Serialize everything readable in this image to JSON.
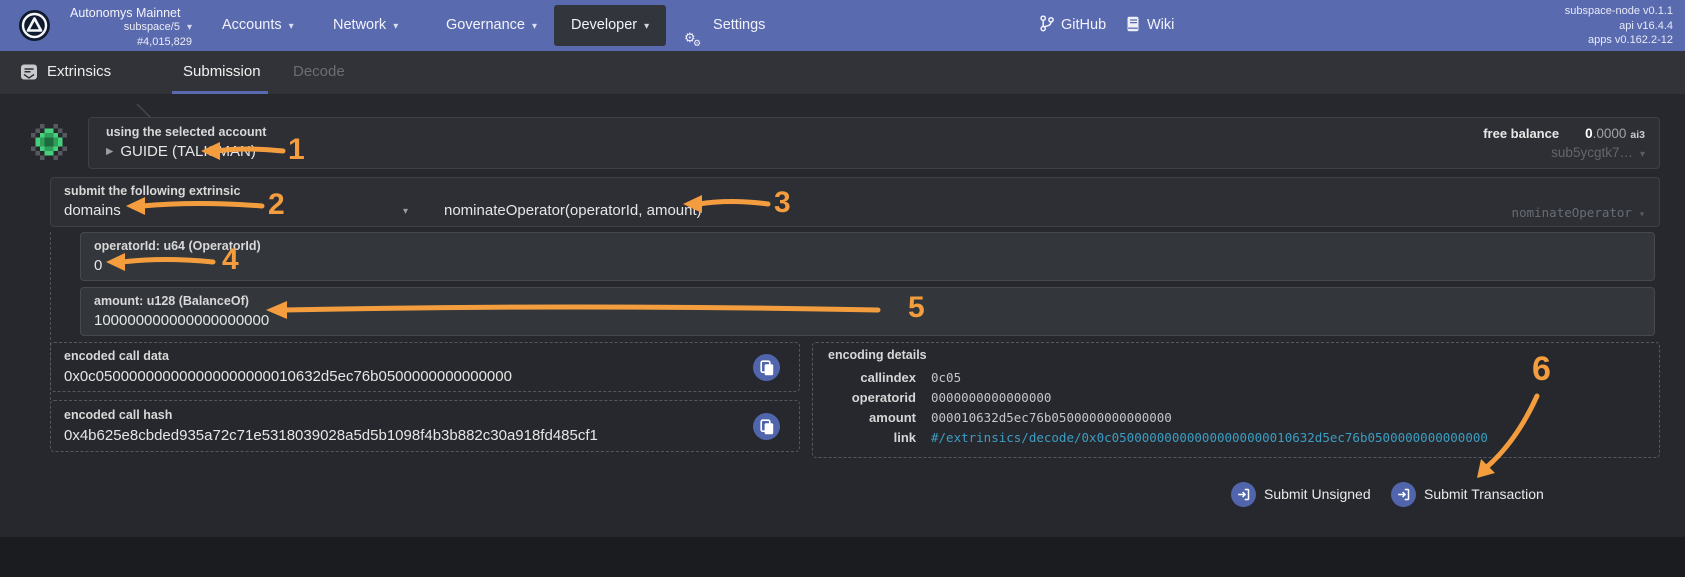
{
  "colors": {
    "nav_blue": "#5a6aae",
    "accent_orange": "#f39d3f",
    "link_blue": "#3d9dc2",
    "button_blue": "#5165ad"
  },
  "nav": {
    "brand": {
      "name": "Autonomys Mainnet",
      "runtime": "subspace/5",
      "block": "#4,015,829"
    },
    "menu": [
      {
        "label": "Accounts"
      },
      {
        "label": "Network"
      },
      {
        "label": "Governance"
      },
      {
        "label": "Developer"
      },
      {
        "label": "Settings"
      }
    ],
    "links": {
      "github": "GitHub",
      "wiki": "Wiki"
    },
    "versions": {
      "node": "subspace-node v0.1.1",
      "api": "api v16.4.4",
      "apps": "apps v0.162.2-12"
    }
  },
  "tabs": {
    "app": "Extrinsics",
    "items": [
      {
        "label": "Submission"
      },
      {
        "label": "Decode"
      }
    ]
  },
  "account": {
    "label": "using the selected account",
    "name": "GUIDE (TALISMAN)",
    "free_balance_label": "free balance",
    "balance_int": "0",
    "balance_frac": ".0000",
    "balance_unit": "ai3",
    "address_short": "sub5ycgtk7…"
  },
  "extrinsic": {
    "label": "submit the following extrinsic",
    "section": "domains",
    "method_signature": "nominateOperator(operatorId, amount)",
    "method_selected": "nominateOperator"
  },
  "params": [
    {
      "label": "operatorId: u64 (OperatorId)",
      "value": "0"
    },
    {
      "label": "amount: u128 (BalanceOf)",
      "value": "100000000000000000000"
    }
  ],
  "outputs": {
    "call_data": {
      "label": "encoded call data",
      "value": "0x0c050000000000000000000010632d5ec76b0500000000000000"
    },
    "call_hash": {
      "label": "encoded call hash",
      "value": "0x4b625e8cbded935a72c71e5318039028a5d5b1098f4b3b882c30a918fd485cf1"
    }
  },
  "encoding": {
    "label": "encoding details",
    "rows": [
      {
        "label": "callindex",
        "value": "0c05"
      },
      {
        "label": "operatorid",
        "value": "0000000000000000"
      },
      {
        "label": "amount",
        "value": "000010632d5ec76b0500000000000000"
      },
      {
        "label": "link",
        "value": "#/extrinsics/decode/0x0c050000000000000000000010632d5ec76b0500000000000000"
      }
    ]
  },
  "actions": {
    "unsigned": "Submit Unsigned",
    "transaction": "Submit Transaction"
  },
  "annotations": {
    "n1": "1",
    "n2": "2",
    "n3": "3",
    "n4": "4",
    "n5": "5",
    "n6": "6"
  }
}
